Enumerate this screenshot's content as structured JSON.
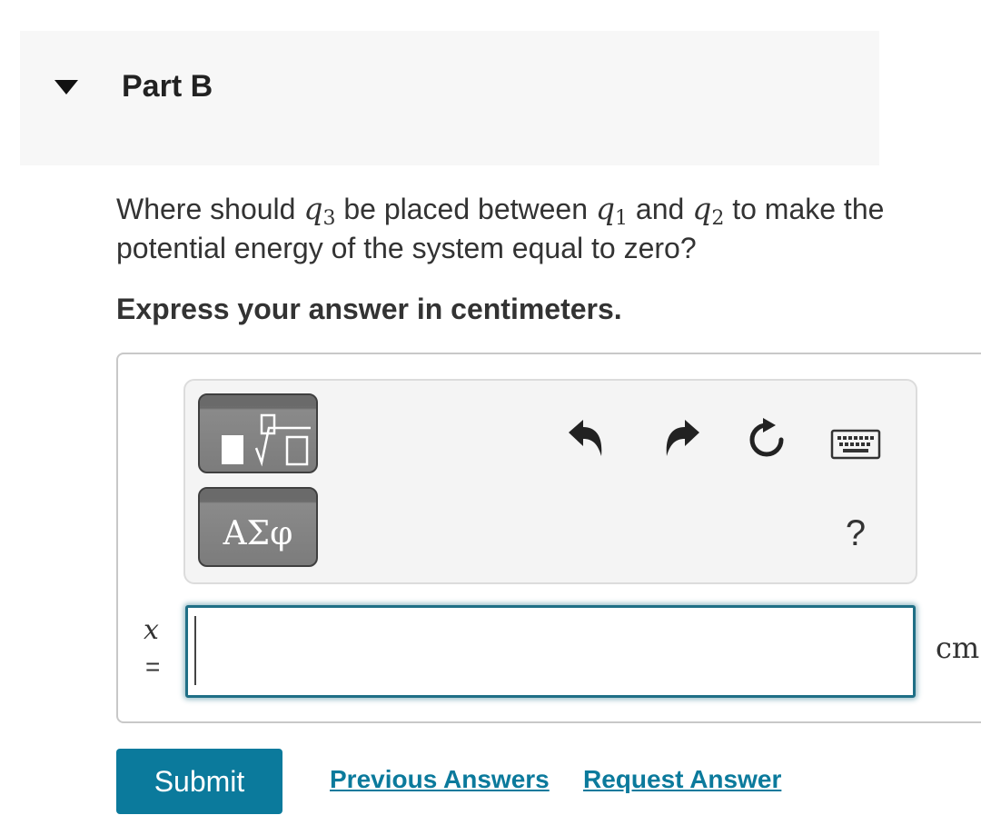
{
  "part": {
    "title": "Part B",
    "toggle_icon": "caret-down-icon"
  },
  "question": {
    "text_before": "Where should ",
    "var_q3": "q",
    "var_q3_sub": "3",
    "text_mid1": " be placed between ",
    "var_q1": "q",
    "var_q1_sub": "1",
    "text_mid2": " and ",
    "var_q2": "q",
    "var_q2_sub": "2",
    "text_after": " to make the potential energy of the system equal to zero?"
  },
  "instruction": "Express your answer in centimeters.",
  "toolbar": {
    "templates_icon": "templates-icon",
    "symbols_label": "ΑΣφ",
    "undo_icon": "undo-icon",
    "redo_icon": "redo-icon",
    "reset_icon": "reset-icon",
    "keyboard_icon": "keyboard-icon",
    "help_label": "?"
  },
  "answer": {
    "variable": "x",
    "equals": "=",
    "value": "",
    "unit": "cm"
  },
  "actions": {
    "submit_label": "Submit",
    "previous_answers_label": "Previous Answers",
    "request_answer_label": "Request Answer"
  },
  "colors": {
    "accent": "#0b7a9c",
    "header_bg": "#f7f7f7",
    "toolbar_bg": "#f4f4f4",
    "input_border": "#1f6f86"
  }
}
